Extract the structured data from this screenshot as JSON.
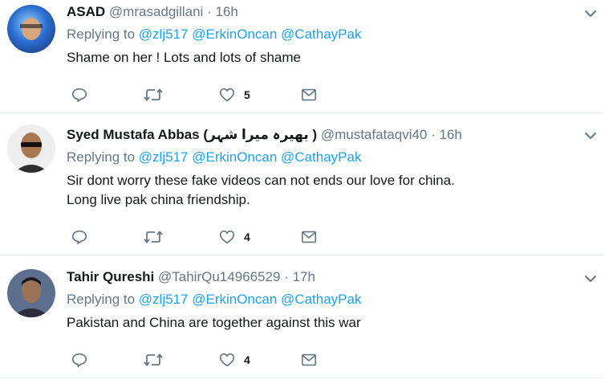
{
  "tweets": [
    {
      "name": "ASAD",
      "handle": "@mrasadgillani",
      "time": "16h",
      "replying_label": "Replying to",
      "mentions": [
        "@zlj517",
        "@ErkinOncan",
        "@CathayPak"
      ],
      "text_lines": [
        "Shame on her ! Lots and lots of shame"
      ],
      "likes": "5"
    },
    {
      "name": "Syed Mustafa Abbas",
      "name_suffix": "(بھیرہ میرا شہر )",
      "handle": "@mustafataqvi40",
      "time": "16h",
      "replying_label": "Replying to",
      "mentions": [
        "@zlj517",
        "@ErkinOncan",
        "@CathayPak"
      ],
      "text_lines": [
        "Sir dont worry these fake videos can not ends our love for china.",
        "Long live pak china friendship."
      ],
      "likes": "4"
    },
    {
      "name": "Tahir Qureshi",
      "handle": "@TahirQu14966529",
      "time": "17h",
      "replying_label": "Replying to",
      "mentions": [
        "@zlj517",
        "@ErkinOncan",
        "@CathayPak"
      ],
      "text_lines": [
        "Pakistan and China are together against this war"
      ],
      "likes": "4"
    }
  ],
  "separator": "·",
  "colors": {
    "accent": "#1da1f2",
    "muted": "#657786",
    "text": "#14171a",
    "border": "#e6ecf0"
  },
  "icons": {
    "reply": "reply-icon",
    "retweet": "retweet-icon",
    "like": "heart-icon",
    "dm": "envelope-icon",
    "menu": "chevron-down-icon"
  }
}
